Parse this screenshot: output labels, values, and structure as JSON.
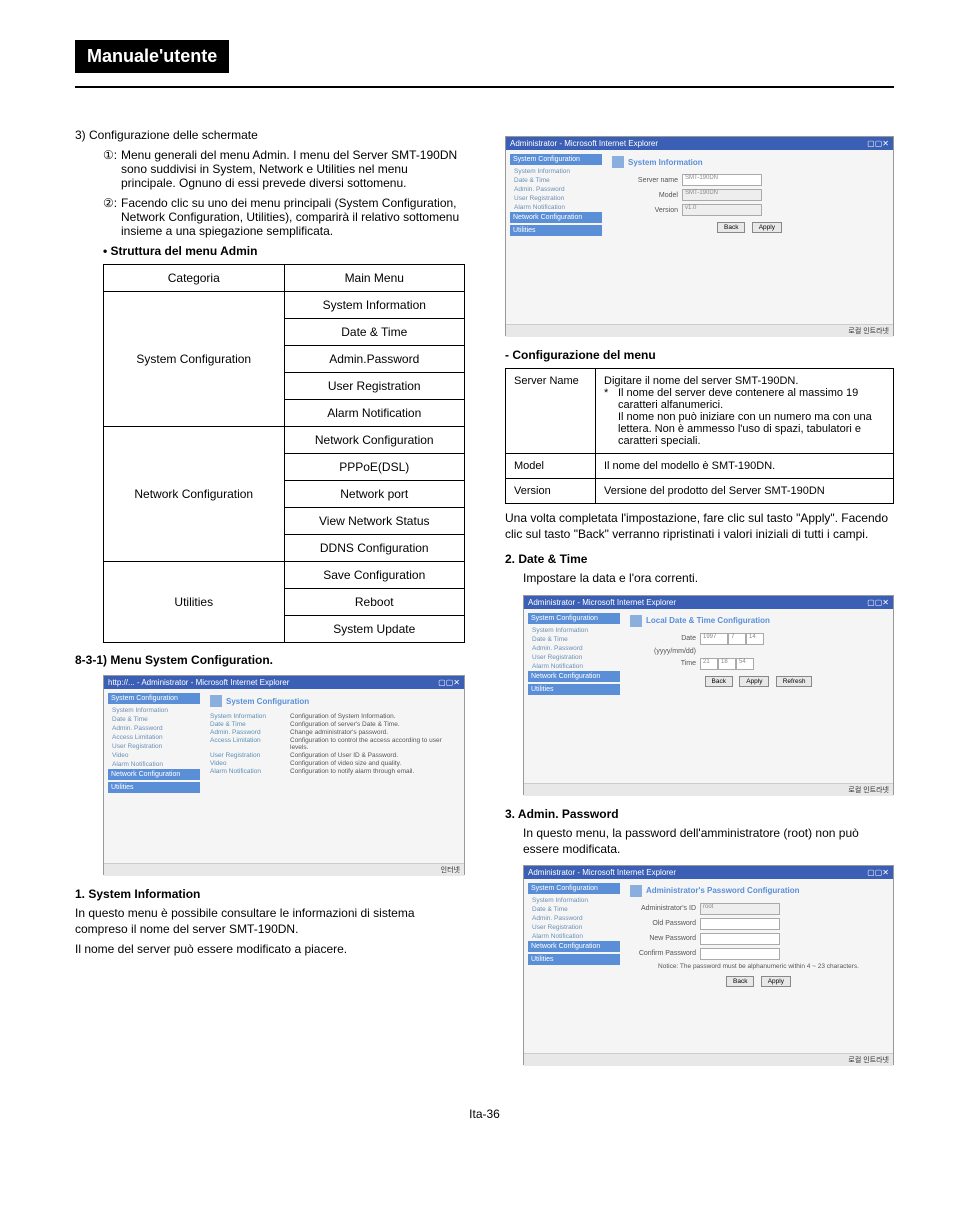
{
  "header": {
    "title": "Manuale'utente"
  },
  "left": {
    "item3": "3)  Configurazione delle schermate",
    "bullet1_sym": "①:",
    "bullet1": "Menu generali del menu Admin. I menu del Server SMT-190DN sono suddivisi in System, Network e Utilities nel menu principale. Ognuno di essi prevede diversi sottomenu.",
    "bullet2_sym": "②:",
    "bullet2": "Facendo clic su uno dei menu principali (System Configuration, Network Configuration, Utilities), comparirà il relativo sottomenu insieme a una spiegazione semplificata.",
    "struct_title": "•   Struttura del menu Admin",
    "table": {
      "hdr_cat": "Categoria",
      "hdr_mm": "Main Menu",
      "rows": [
        {
          "cat": "System Configuration",
          "items": [
            "System Information",
            "Date & Time",
            "Admin.Password",
            "User Registration",
            "Alarm Notification"
          ]
        },
        {
          "cat": "Network Configuration",
          "items": [
            "Network Configuration",
            "PPPoE(DSL)",
            "Network port",
            "View Network Status",
            "DDNS Configuration"
          ]
        },
        {
          "cat": "Utilities",
          "items": [
            "Save Configuration",
            "Reboot",
            "System Update"
          ]
        }
      ]
    },
    "sec831": "8-3-1) Menu System Configuration.",
    "ss1": {
      "titlebar": "http://... - Administrator - Microsoft Internet Explorer",
      "side_hdr1": "System Configuration",
      "side_items1": [
        "System Information",
        "Date & Time",
        "Admin. Password",
        "Access Limitation",
        "User Registration",
        "Video",
        "Alarm Notification"
      ],
      "side_hdr2": "Network Configuration",
      "side_hdr3": "Utilities",
      "main_title": "System Configuration",
      "list": [
        {
          "l": "System Information",
          "r": "Configuration of System Information."
        },
        {
          "l": "Date & Time",
          "r": "Configuration of server's Date & Time."
        },
        {
          "l": "Admin. Password",
          "r": "Change administrator's password."
        },
        {
          "l": "Access Limitation",
          "r": "Configuration to control the access according to user levels."
        },
        {
          "l": "User Registration",
          "r": "Configuration of User ID & Password."
        },
        {
          "l": "Video",
          "r": "Configuration of video size and quality."
        },
        {
          "l": "Alarm Notification",
          "r": "Configuration to notify alarm through email."
        }
      ],
      "status": "인터넷"
    },
    "sec1_title": "1. System Information",
    "sec1_p1": "In questo menu è possibile consultare le informazioni di sistema compreso il nome del server SMT-190DN.",
    "sec1_p2": "Il nome del server può essere modificato a piacere."
  },
  "right": {
    "ss_sysinfo": {
      "titlebar": "Administrator - Microsoft Internet Explorer",
      "side_hdr1": "System Configuration",
      "side_items": [
        "System Information",
        "Date & Time",
        "Admin. Password",
        "User Registration",
        "Alarm Notification"
      ],
      "side_hdr2": "Network Configuration",
      "side_hdr3": "Utilities",
      "main_title": "System Information",
      "rows": [
        {
          "label": "Server name",
          "val": "SMT-190DN"
        },
        {
          "label": "Model",
          "val": "SMT-190DN"
        },
        {
          "label": "Version",
          "val": "v1.0"
        }
      ],
      "btn_back": "Back",
      "btn_apply": "Apply",
      "status": "로컬 인트라넷"
    },
    "config_title": "- Configurazione del menu",
    "config_rows": [
      {
        "k": "Server Name",
        "v": "Digitare il nome del server SMT-190DN.",
        "star": "*",
        "note": "Il nome del server deve contenere al massimo 19 caratteri alfanumerici.\nIl nome non può iniziare con un numero ma con una lettera. Non è ammesso l'uso di spazi, tabulatori e caratteri speciali."
      },
      {
        "k": "Model",
        "v": "Il nome del modello è SMT-190DN."
      },
      {
        "k": "Version",
        "v": "Versione del prodotto del Server SMT-190DN"
      }
    ],
    "after_table": "Una volta completata l'impostazione, fare clic sul tasto \"Apply\". Facendo clic sul tasto \"Back\" verranno ripristinati i valori iniziali di tutti i campi.",
    "sec2_title": "2.  Date & Time",
    "sec2_body": "Impostare la data e l'ora correnti.",
    "ss_datetime": {
      "titlebar": "Administrator - Microsoft Internet Explorer",
      "main_title": "Local Date & Time Configuration",
      "date_label": "Date",
      "date_vals": [
        "1997",
        "7",
        "14"
      ],
      "date_fmt": "(yyyy/mm/dd)",
      "time_label": "Time",
      "time_vals": [
        "21",
        "18",
        "54"
      ],
      "btn_back": "Back",
      "btn_apply": "Apply",
      "btn_refresh": "Refresh",
      "status": "로컬 인트라넷"
    },
    "sec3_title": "3.  Admin. Password",
    "sec3_body": "In questo menu, la password dell'amministratore (root) non può essere modificata.",
    "ss_pwd": {
      "titlebar": "Administrator - Microsoft Internet Explorer",
      "main_title": "Administrator's Password Configuration",
      "rows": [
        {
          "label": "Administrator's ID",
          "val": "root"
        },
        {
          "label": "Old Password",
          "val": ""
        },
        {
          "label": "New Password",
          "val": ""
        },
        {
          "label": "Confirm Password",
          "val": ""
        }
      ],
      "notice": "Notice: The password must be alphanumeric within 4 ~ 23 characters.",
      "btn_back": "Back",
      "btn_apply": "Apply",
      "status": "로컬 인트라넷"
    }
  },
  "page_num": "Ita-36"
}
